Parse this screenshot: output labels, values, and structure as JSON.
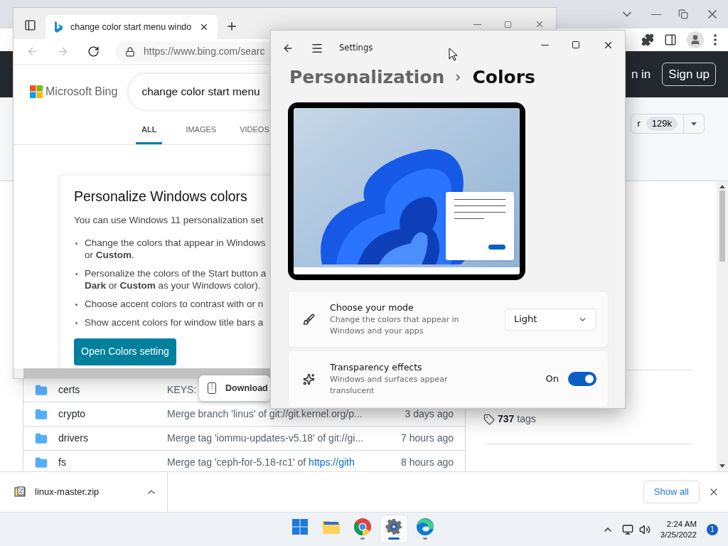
{
  "chrome_window": {
    "github": {
      "header": {
        "sign_in": "n in",
        "sign_up": "Sign up"
      },
      "star_button": {
        "label": "r",
        "count": "129k"
      },
      "files": [
        {
          "name": "certs",
          "message": "KEYS:"
        },
        {
          "name": "crypto",
          "message": "Merge branch 'linus' of git://git.kernel.org/p...",
          "time": "3 days ago"
        },
        {
          "name": "drivers",
          "message": "Merge tag 'iommu-updates-v5.18' of git://gi...",
          "time": "7 hours ago"
        },
        {
          "name": "fs",
          "message": "Merge tag 'ceph-for-5.18-rc1' of",
          "message_link": "https://gith",
          "time": "8 hours ago"
        }
      ],
      "tags": "**737** tags"
    },
    "download_bar": {
      "file": "linux-master.zip",
      "show_all": "Show all"
    }
  },
  "download_bubble": {
    "label": "Download"
  },
  "edge_window": {
    "tab_title": "change color start menu windo",
    "address": "https://www.bing.com/searc",
    "brand": "Microsoft Bing",
    "search_query": "change color start menu",
    "tabs": [
      {
        "label": "ALL",
        "selected": true
      },
      {
        "label": "IMAGES",
        "selected": false
      },
      {
        "label": "VIDEOS",
        "selected": false
      }
    ],
    "card": {
      "title": "Personalize Windows colors",
      "intro": "You can use Windows 11 personalization set",
      "bullets": [
        {
          "lines": [
            "Change the colors that appear in Windows",
            "or **Custom**."
          ]
        },
        {
          "lines": [
            "Personalize the colors of the Start button a",
            "**Dark** or **Custom** as your Windows color)."
          ]
        },
        {
          "lines": [
            "Choose accent colors to contrast with or n"
          ]
        },
        {
          "lines": [
            "Show accent colors for window title bars a"
          ]
        }
      ],
      "button": "Open Colors setting"
    }
  },
  "settings_window": {
    "title": "Settings",
    "breadcrumb": [
      "Personalization",
      "Colors"
    ],
    "cards": [
      {
        "kind": "dropdown",
        "title": "Choose your mode",
        "description": [
          "Change the colors that appear in",
          "Windows and your apps"
        ],
        "value": "Light"
      },
      {
        "kind": "toggle",
        "title": "Transparency effects",
        "description": [
          "Windows and surfaces appear",
          "translucent"
        ],
        "state_label": "On",
        "on": true
      }
    ]
  },
  "taskbar": {
    "apps": [
      {
        "kind": "start",
        "selected": false,
        "running": false
      },
      {
        "kind": "explorer",
        "selected": false,
        "running": false
      },
      {
        "kind": "chrome",
        "selected": false,
        "running": true
      },
      {
        "kind": "settings",
        "selected": true,
        "running": true
      },
      {
        "kind": "edge",
        "selected": false,
        "running": true
      }
    ],
    "time": "2:24 AM",
    "date": "3/25/2022",
    "notifications": "1"
  }
}
